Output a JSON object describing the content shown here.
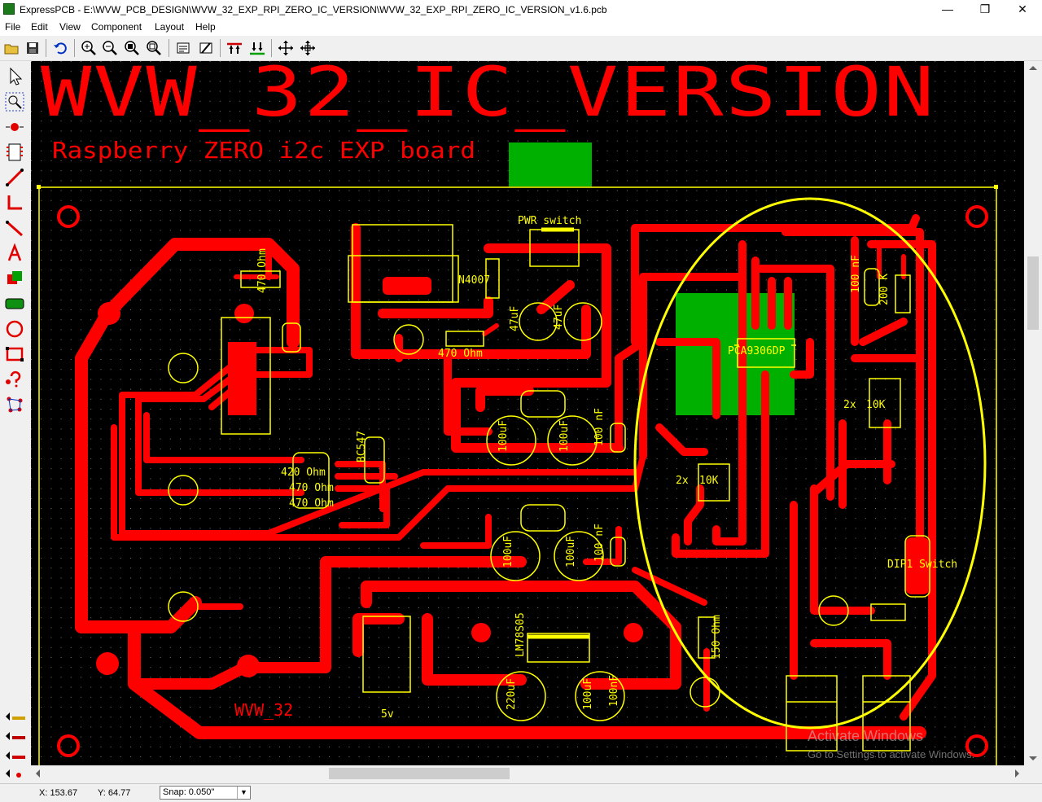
{
  "window": {
    "title": "ExpressPCB - E:\\WVW_PCB_DESIGN\\WVW_32_EXP_RPI_ZERO_IC_VERSION\\WVW_32_EXP_RPI_ZERO_IC_VERSION_v1.6.pcb",
    "minimize": "—",
    "maximize": "❐",
    "close": "✕"
  },
  "menu": {
    "items": [
      "File",
      "Edit",
      "View",
      "Component",
      "Layout",
      "Help"
    ]
  },
  "board": {
    "big_title": "WVW_32_IC_VERSION",
    "subtitle": "Raspberry ZERO i2c EXP board",
    "labels": {
      "pwr_switch": "PWR switch",
      "n4007": "N4007",
      "r470_top": "470 Ohm",
      "r470_mid": "470 Ohm",
      "cap47_a": "47uF",
      "cap47_b": "47uF",
      "ic": "PCA9306DP",
      "cap100n_top": "100 nF",
      "r200k": "200 K",
      "r10k_a": "10K",
      "r10k_b": "10K",
      "x2_a": "2x",
      "x2_b": "2x",
      "bc547": "BC547",
      "r420": "420 Ohm",
      "r470_b": "470 Ohm",
      "r470_c": "470 Ohm",
      "cap100u_a": "100uF",
      "cap100u_b": "100uF",
      "cap100n_a": "100 nF",
      "cap100u_c": "100uF",
      "cap100u_d": "100uF",
      "cap100n_b": "100 nF",
      "dip": "DIP1 Switch",
      "r150": "150 Ohm",
      "lm": "LM78S05",
      "cap220u": "220uF",
      "cap100u_e": "100uF",
      "cap100n_c": "100nF",
      "wvw": "WVW_32",
      "five_v": "5v"
    }
  },
  "status": {
    "x": "X: 153.67",
    "y": "Y: 64.77",
    "snap": "Snap:  0.050\""
  },
  "watermark": {
    "line1": "Activate Windows",
    "line2": "Go to Settings to activate Windows."
  },
  "colors": {
    "trace": "#ff0000",
    "silkscreen": "#ffff00",
    "copper_fill": "#00b000",
    "background": "#000000"
  }
}
